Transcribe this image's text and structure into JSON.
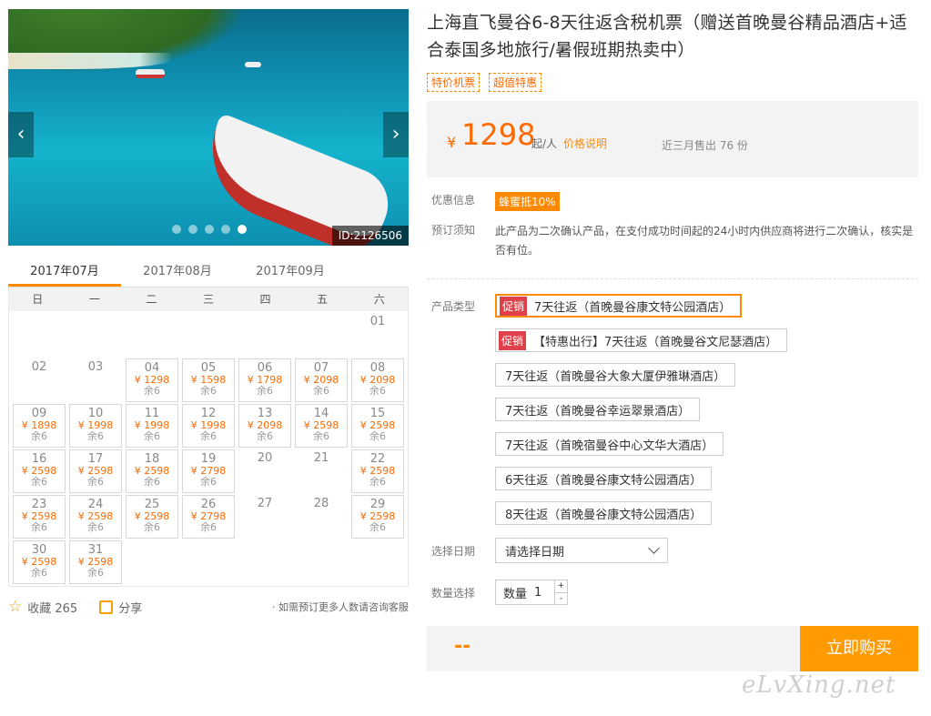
{
  "hero": {
    "id_tag": "ID:2126506",
    "dots": 5,
    "active_dot": 4
  },
  "months": [
    "2017年07月",
    "2017年08月",
    "2017年09月"
  ],
  "weekdays": [
    "日",
    "一",
    "二",
    "三",
    "四",
    "五",
    "六"
  ],
  "calendar": [
    {
      "d": "",
      "p": "",
      "s": ""
    },
    {
      "d": "",
      "p": "",
      "s": ""
    },
    {
      "d": "",
      "p": "",
      "s": ""
    },
    {
      "d": "",
      "p": "",
      "s": ""
    },
    {
      "d": "",
      "p": "",
      "s": ""
    },
    {
      "d": "",
      "p": "",
      "s": ""
    },
    {
      "d": "01",
      "p": "",
      "s": ""
    },
    {
      "d": "02",
      "p": "",
      "s": ""
    },
    {
      "d": "03",
      "p": "",
      "s": ""
    },
    {
      "d": "04",
      "p": "¥ 1298",
      "s": "余6"
    },
    {
      "d": "05",
      "p": "¥ 1598",
      "s": "余6"
    },
    {
      "d": "06",
      "p": "¥ 1798",
      "s": "余6"
    },
    {
      "d": "07",
      "p": "¥ 2098",
      "s": "余6"
    },
    {
      "d": "08",
      "p": "¥ 2098",
      "s": "余6"
    },
    {
      "d": "09",
      "p": "¥ 1898",
      "s": "余6"
    },
    {
      "d": "10",
      "p": "¥ 1998",
      "s": "余6"
    },
    {
      "d": "11",
      "p": "¥ 1998",
      "s": "余6"
    },
    {
      "d": "12",
      "p": "¥ 1998",
      "s": "余6"
    },
    {
      "d": "13",
      "p": "¥ 2098",
      "s": "余6"
    },
    {
      "d": "14",
      "p": "¥ 2598",
      "s": "余6"
    },
    {
      "d": "15",
      "p": "¥ 2598",
      "s": "余6"
    },
    {
      "d": "16",
      "p": "¥ 2598",
      "s": "余6"
    },
    {
      "d": "17",
      "p": "¥ 2598",
      "s": "余6"
    },
    {
      "d": "18",
      "p": "¥ 2598",
      "s": "余6"
    },
    {
      "d": "19",
      "p": "¥ 2798",
      "s": "余6"
    },
    {
      "d": "20",
      "p": "",
      "s": ""
    },
    {
      "d": "21",
      "p": "",
      "s": ""
    },
    {
      "d": "22",
      "p": "¥ 2598",
      "s": "余6"
    },
    {
      "d": "23",
      "p": "¥ 2598",
      "s": "余6"
    },
    {
      "d": "24",
      "p": "¥ 2598",
      "s": "余6"
    },
    {
      "d": "25",
      "p": "¥ 2598",
      "s": "余6"
    },
    {
      "d": "26",
      "p": "¥ 2798",
      "s": "余6"
    },
    {
      "d": "27",
      "p": "",
      "s": ""
    },
    {
      "d": "28",
      "p": "",
      "s": ""
    },
    {
      "d": "29",
      "p": "¥ 2598",
      "s": "余6"
    },
    {
      "d": "30",
      "p": "¥ 2598",
      "s": "余6"
    },
    {
      "d": "31",
      "p": "¥ 2598",
      "s": "余6"
    }
  ],
  "share": {
    "fav_label": "收藏 265",
    "share_label": "分享",
    "note": "· 如需预订更多人数请咨询客服"
  },
  "title": "上海直飞曼谷6-8天往返含税机票（赠送首晚曼谷精品酒店+适合泰国多地旅行/暑假班期热卖中）",
  "tags": [
    "特价机票",
    "超值特惠"
  ],
  "price": {
    "currency": "¥",
    "value": "1298",
    "unit": "起/人",
    "explain": "价格说明",
    "sold": "近三月售出 76 份"
  },
  "discount": {
    "label": "优惠信息",
    "badge": "蜂蜜抵10%"
  },
  "notice": {
    "label": "预订须知",
    "text": "此产品为二次确认产品，在支付成功时间起的24小时内供应商将进行二次确认，核实是否有位。"
  },
  "product": {
    "label": "产品类型",
    "items": [
      {
        "promo": "促销",
        "text": "7天往返（首晚曼谷康文特公园酒店）"
      },
      {
        "promo": "促销",
        "text": "【特惠出行】7天往返（首晚曼谷文尼瑟酒店）"
      },
      {
        "promo": "",
        "text": "7天往返（首晚曼谷大象大厦伊雅琳酒店）"
      },
      {
        "promo": "",
        "text": "7天往返（首晚曼谷幸运翠景酒店）"
      },
      {
        "promo": "",
        "text": "7天往返（首晚宿曼谷中心文华大酒店）"
      },
      {
        "promo": "",
        "text": "6天往返（首晚曼谷康文特公园酒店）"
      },
      {
        "promo": "",
        "text": "8天往返（首晚曼谷康文特公园酒店）"
      }
    ]
  },
  "date": {
    "label": "选择日期",
    "value": "请选择日期"
  },
  "quantity": {
    "label": "数量选择",
    "prefix": "数量",
    "value": "1",
    "plus": "+",
    "minus": "-"
  },
  "buy": {
    "dash": "--",
    "button": "立即购买"
  },
  "watermark": "eLvXing.net"
}
